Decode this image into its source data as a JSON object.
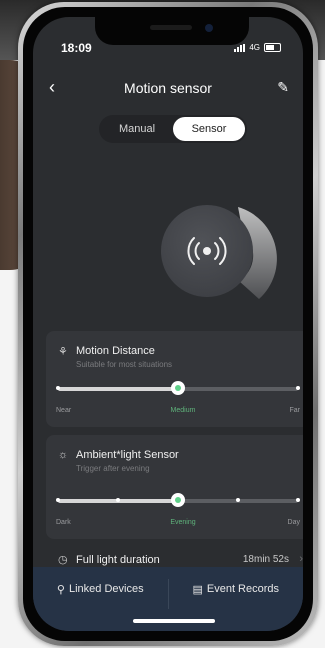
{
  "status_bar": {
    "time": "18:09",
    "network": "4G"
  },
  "header": {
    "back_icon": "chevron-left-icon",
    "title": "Motion sensor",
    "edit_icon": "pencil-icon"
  },
  "mode_toggle": {
    "options": [
      "Manual",
      "Sensor"
    ],
    "selected": "Sensor"
  },
  "sensor_icon": "radar-pulse-icon",
  "motion_distance": {
    "title": "Motion Distance",
    "subtitle": "Suitable for most situations",
    "scale": [
      "Near",
      "Medium",
      "Far"
    ],
    "value_fraction": 0.5
  },
  "ambient_light": {
    "title": "Ambient*light Sensor",
    "subtitle": "Trigger after evening",
    "scale": [
      "Dark",
      "Evening",
      "Day"
    ],
    "steps": 5,
    "value_fraction": 0.5
  },
  "full_light_duration": {
    "label": "Full light duration",
    "value": "18min 52s"
  },
  "bottom_bar": {
    "linked_devices": "Linked Devices",
    "event_records": "Event Records"
  },
  "colors": {
    "accent": "#5fd08a",
    "screen_bg": "#2b2d30",
    "card_bg": "#34363a",
    "bottom_bar_bg": "#263346"
  }
}
